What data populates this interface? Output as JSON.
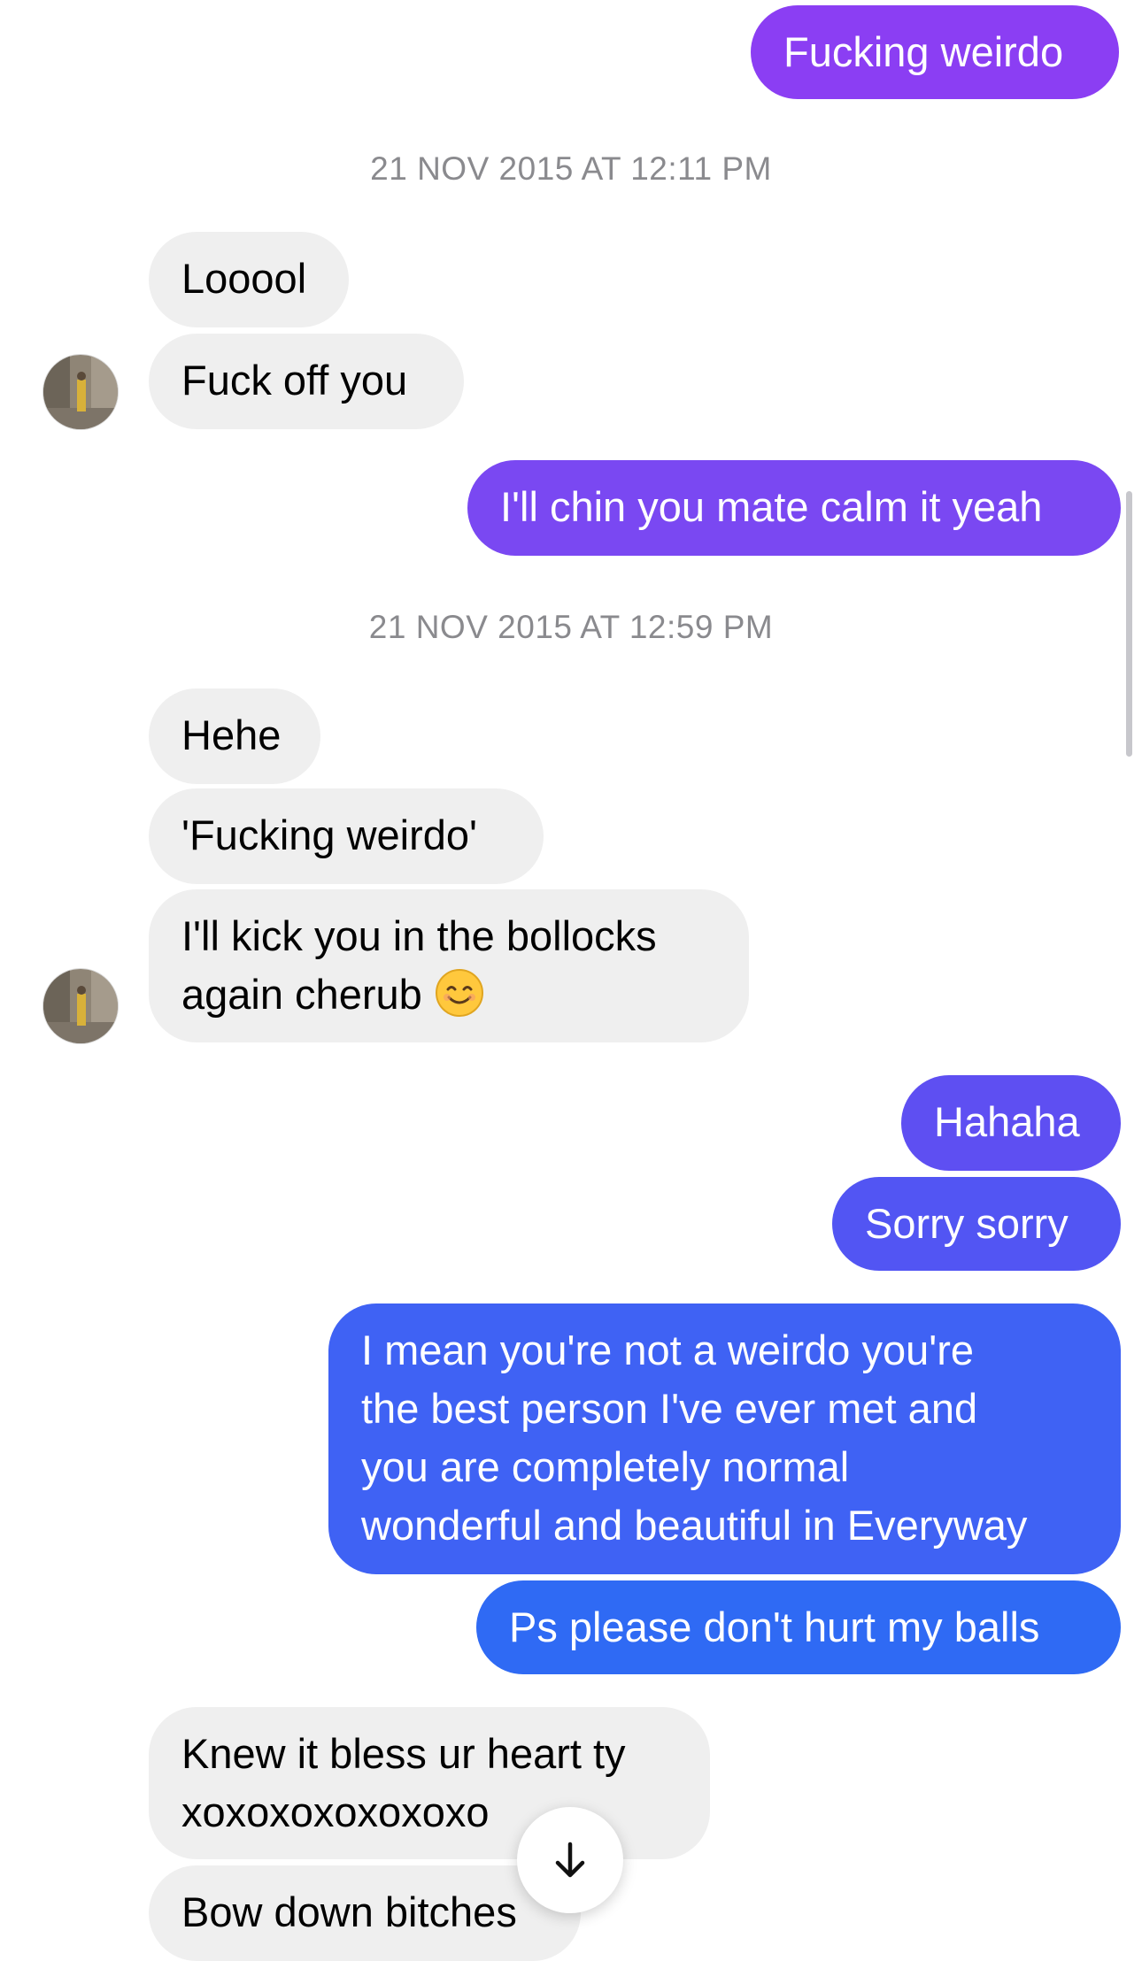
{
  "timestamps": [
    "21 NOV 2015 AT 12:11 PM",
    "21 NOV 2015 AT 12:59 PM"
  ],
  "messages": {
    "m0": "Fucking weirdo",
    "m1": "Looool",
    "m2": "Fuck off you",
    "m3": "I'll chin you mate calm it yeah",
    "m4": "Hehe",
    "m5": "'Fucking weirdo'",
    "m6_line1": "I'll kick you in the bollocks",
    "m6_line2": "again cherub",
    "m7": "Hahaha",
    "m8": "Sorry sorry",
    "m9_line1": "I mean you're not a weirdo you're",
    "m9_line2": "the best person I've ever met and",
    "m9_line3": "you are completely normal",
    "m9_line4": "wonderful and beautiful in Everyway",
    "m10": "Ps please don't hurt my balls",
    "m11_line1": "Knew it bless ur heart ty",
    "m11_line2": "xoxoxoxoxoxoxo",
    "m12": "Bow down bitches"
  },
  "icons": {
    "emoji": "smiling-face-emoji",
    "scroll_down": "arrow-down-icon"
  },
  "colors": {
    "incoming_bubble": "#efefef",
    "outgoing_gradient": [
      "#8b3ef3",
      "#7a48f2",
      "#5e4ff2",
      "#4a5cf4",
      "#2f6af4"
    ],
    "timestamp": "#8a8a8e"
  }
}
